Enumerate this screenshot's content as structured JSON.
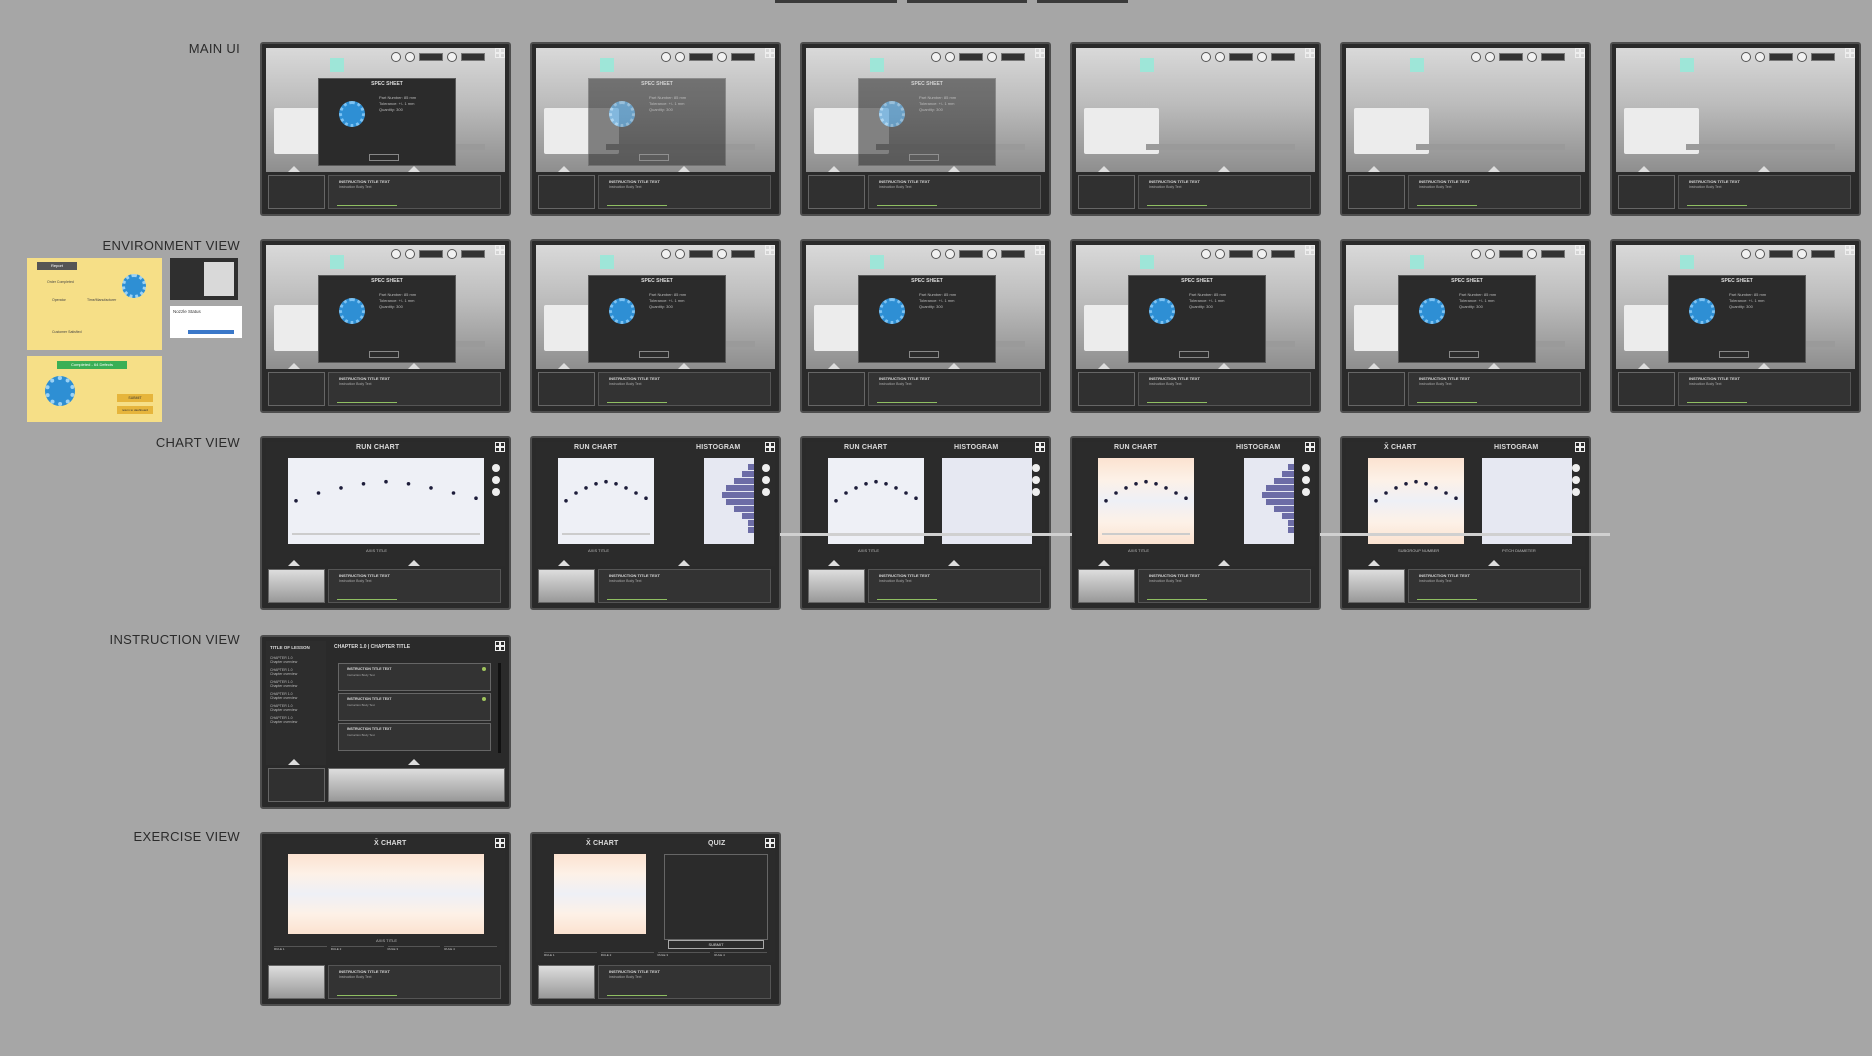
{
  "row_labels": {
    "main_ui": "MAIN UI",
    "environment_view": "ENVIRONMENT VIEW",
    "chart_view": "CHART VIEW",
    "instruction_view": "INSTRUCTION VIEW",
    "exercise_view": "EXERCISE VIEW"
  },
  "spec_sheet": {
    "title": "SPEC SHEET",
    "part_number": "Part Number:  85 mm",
    "tolerance": "Tolerance:  +/- 1 mm",
    "quantity": "Quantity:  300",
    "button": "CLOSE"
  },
  "instruction": {
    "title": "INSTRUCTION TITLE TEXT",
    "body": "Instruction Body Text"
  },
  "chart_view": {
    "run_chart": "RUN CHART",
    "histogram": "HISTOGRAM",
    "xbar_chart": "X̄ CHART",
    "axis_title": "AXIS TITLE",
    "subgroup_number": "SUBGROUP NUMBER",
    "pitch_diameter": "PITCH DIAMETER"
  },
  "instruction_view": {
    "lesson_title": "TITLE OF LESSON",
    "chapter_header": "CHAPTER 1.0 | CHAPTER TITLE",
    "chapters": [
      "CHAPTER 1.0",
      "CHAPTER 1.0",
      "CHAPTER 1.0",
      "CHAPTER 1.0",
      "CHAPTER 1.0",
      "CHAPTER 1.0"
    ],
    "chapter_overview": "Chapter overview"
  },
  "exercise_view": {
    "xbar_chart": "X̄ CHART",
    "quiz": "QUIZ",
    "submit": "SUBMIT",
    "rules": [
      "RULE 1",
      "RULE 2",
      "RULE 3",
      "RULE 4"
    ]
  },
  "environment_notes": {
    "report": "Report",
    "order_completed": "Order Completed",
    "operator": "Operator",
    "time_manufacturer": "Time/Manufacturer",
    "customer_satisfied": "Customer Satisfied",
    "nozzle_gauge": "Nozzle Status",
    "completed_label": "Completed - 64 Defects",
    "submit": "SUBMIT",
    "return": "return to dashboard"
  },
  "run_chart_points": [
    0.55,
    0.4,
    0.3,
    0.22,
    0.18,
    0.22,
    0.3,
    0.4,
    0.5
  ],
  "colors": {
    "background": "#a6a6a6",
    "frame": "#2a2a2a",
    "histogram_bar": "#6c6ca6",
    "gear": "#2e8fd4",
    "progress": "#8fbf62",
    "sticky": "#f6df87"
  }
}
